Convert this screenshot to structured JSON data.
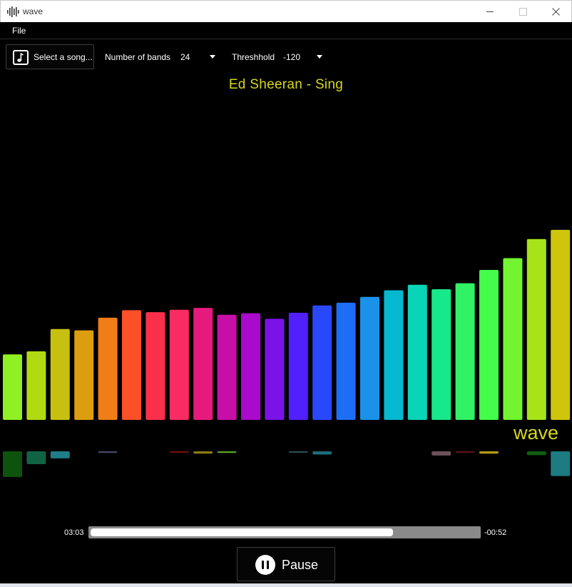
{
  "window": {
    "title": "wave",
    "icon": "waveform-icon"
  },
  "menu": {
    "file_label": "File"
  },
  "toolbar": {
    "select_song_label": "Select a song...",
    "bands_label": "Number of bands",
    "bands_value": "24",
    "threshold_label": "Threshhold",
    "threshold_value": "-120"
  },
  "song_title": "Ed Sheeran - Sing",
  "watermark": "wave",
  "colors": {
    "title_yellow": "#d6d81a",
    "bands": [
      "#8ff023",
      "#b0db12",
      "#c8c010",
      "#dc9e0e",
      "#f07d18",
      "#fc5028",
      "#fa304a",
      "#f82c62",
      "#e61a7c",
      "#c70ea6",
      "#aa0acb",
      "#7b12e7",
      "#5120fc",
      "#2a48fb",
      "#1c6ef5",
      "#1b92ea",
      "#06b8d0",
      "#0ad4b8",
      "#17e88a",
      "#30f264",
      "#44fd4a",
      "#72f530",
      "#a6e418",
      "#cfc60b"
    ],
    "reflection": [
      "#0d520d",
      "#116344",
      "#1e7d88",
      "",
      "#454a66",
      "",
      "",
      "#7a1010",
      "#8a7b12",
      "#5ba42a",
      "",
      "",
      "#2e4f5a",
      "#1e6b7a",
      "",
      "",
      "",
      "",
      "#6e515a",
      "#5e1414",
      "#b89a16",
      "",
      "#0f5e12",
      "#1d7b82"
    ]
  },
  "spectrum": {
    "band_count": 24,
    "levels": [
      0.306,
      0.32,
      0.424,
      0.418,
      0.477,
      0.512,
      0.503,
      0.514,
      0.523,
      0.491,
      0.498,
      0.472,
      0.5,
      0.534,
      0.547,
      0.574,
      0.605,
      0.631,
      0.61,
      0.638,
      0.7,
      0.755,
      0.844,
      0.887
    ],
    "reflection_levels": [
      0.8,
      0.4,
      0.22,
      0,
      0.05,
      0,
      0,
      0.03,
      0.07,
      0.05,
      0,
      0,
      0.03,
      0.1,
      0,
      0,
      0,
      0,
      0.13,
      0.04,
      0.07,
      0,
      0.12,
      0.77
    ]
  },
  "player": {
    "elapsed": "03:03",
    "remaining": "-00:52",
    "progress": 0.78,
    "pause_label": "Pause"
  }
}
